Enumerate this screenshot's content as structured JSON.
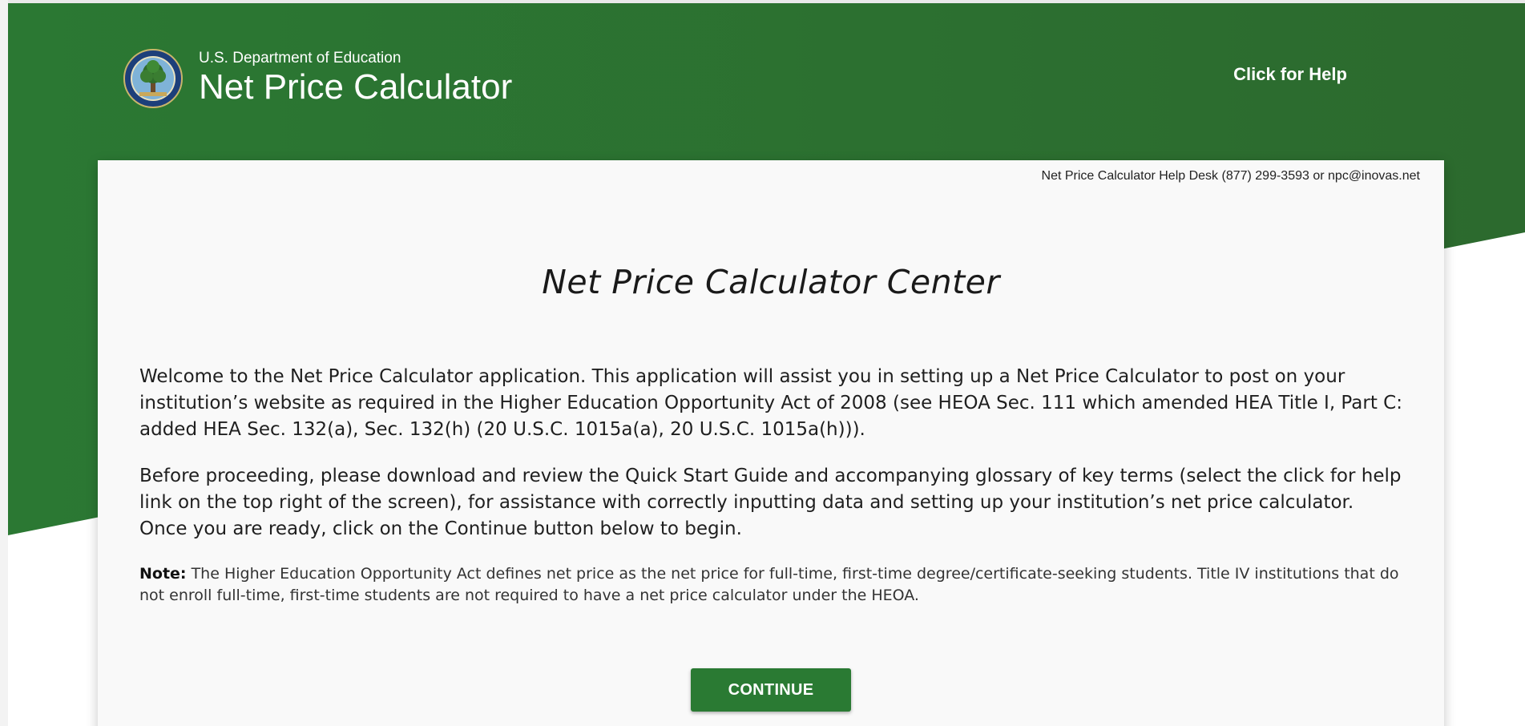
{
  "header": {
    "department": "U.S. Department of Education",
    "app_name": "Net Price Calculator",
    "help_link": "Click for Help",
    "seal_icon": "department-of-education-seal-icon"
  },
  "card": {
    "helpdesk": "Net Price Calculator Help Desk (877) 299-3593 or npc@inovas.net",
    "title": "Net Price Calculator Center",
    "paragraph1": "Welcome to the Net Price Calculator application. This application will assist you in setting up a Net Price Calculator to post on your institution’s website as required in the Higher Education Opportunity Act of 2008 (see HEOA Sec. 111 which amended HEA Title I, Part C: added HEA Sec. 132(a), Sec. 132(h) (20 U.S.C. 1015a(a), 20 U.S.C. 1015a(h))).",
    "paragraph2": "Before proceeding, please download and review the Quick Start Guide and accompanying glossary of key terms (select the click for help link on the top right of the screen), for assistance with correctly inputting data and setting up your institution’s net price calculator. Once you are ready, click on the Continue button below to begin.",
    "note_label": "Note:",
    "note_text": " The Higher Education Opportunity Act defines net price as the net price for full-time, first-time degree/certificate-seeking students. Title IV institutions that do not enroll full-time, first-time students are not required to have a net price calculator under the HEOA.",
    "continue_label": "CONTINUE"
  },
  "colors": {
    "header_green": "#2e7d32",
    "button_green": "#2a7a33",
    "card_bg": "#f9f9f9"
  }
}
